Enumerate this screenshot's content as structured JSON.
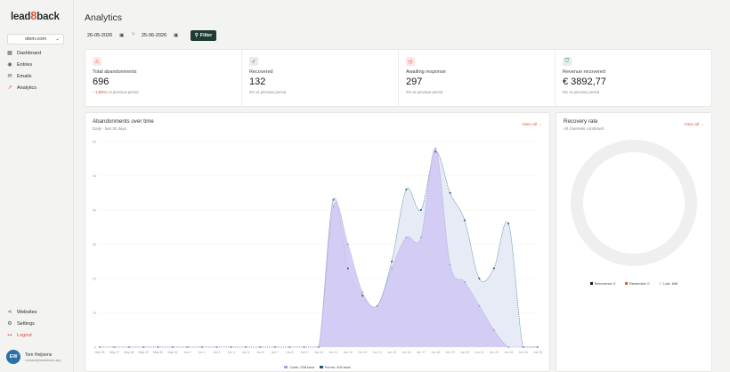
{
  "brand": {
    "part1": "lead",
    "part2": "8",
    "part3": "back"
  },
  "workspace": {
    "name": "olem.com"
  },
  "nav": [
    {
      "label": "Dashboard",
      "icon": "grid-icon"
    },
    {
      "label": "Entries",
      "icon": "eye-icon"
    },
    {
      "label": "Emails",
      "icon": "mail-icon"
    },
    {
      "label": "Analytics",
      "icon": "chart-icon"
    }
  ],
  "nav_bottom": [
    {
      "label": "Websites",
      "icon": "share-icon"
    },
    {
      "label": "Settings",
      "icon": "gear-icon"
    },
    {
      "label": "Logout",
      "icon": "logout-icon"
    }
  ],
  "user": {
    "initials": "EW",
    "name": "Tom Heijnens",
    "email": "contact@leadsback.app"
  },
  "page": {
    "title": "Analytics"
  },
  "filters": {
    "date_from": "26-05-2026",
    "date_to": "25-06-2026",
    "filter_label": "Filter",
    "separator": ">"
  },
  "stats": [
    {
      "label": "Total abandonments",
      "value": "696",
      "arrow": "↑",
      "sub_highlight": "1400%",
      "sub": "vs previous period",
      "icon": "alert-icon",
      "icon_bg": "#fde8e4",
      "icon_color": "#e0553b"
    },
    {
      "label": "Recovered",
      "value": "132",
      "sub": "0% vs previous period",
      "icon": "check-icon",
      "icon_bg": "#e8ece9",
      "icon_color": "#4a5a52"
    },
    {
      "label": "Awaiting response",
      "value": "297",
      "sub": "0% vs previous period",
      "icon": "clock-icon",
      "icon_bg": "#fde8e4",
      "icon_color": "#e0553b"
    },
    {
      "label": "Revenue recovered",
      "value": "€ 3892,77",
      "sub": "0% vs previous period",
      "icon": "wallet-icon",
      "icon_bg": "#e4eeea",
      "icon_color": "#3b6b5c"
    }
  ],
  "abandon_card": {
    "title": "Abandonments over time",
    "subtitle": "Daily - last 30 days",
    "view_all": "View all →"
  },
  "recovery_card": {
    "title": "Recovery rate",
    "subtitle": "All channels combined",
    "view_all": "View all →",
    "legend": [
      {
        "label": "Recovered: 0",
        "color": "#1a1a1a"
      },
      {
        "label": "Reminded: 0",
        "color": "#e0553b"
      },
      {
        "label": "Lost: 696",
        "color": "#e8e8e8"
      }
    ]
  },
  "chart_data": {
    "type": "area",
    "categories": [
      "May 26",
      "May 27",
      "May 28",
      "May 29",
      "May 30",
      "May 31",
      "Jun 1",
      "Jun 2",
      "Jun 3",
      "Jun 4",
      "Jun 5",
      "Jun 6",
      "Jun 7",
      "Jun 8",
      "Jun 9",
      "Jun 10",
      "Jun 11",
      "Jun 12",
      "Jun 13",
      "Jun 14",
      "Jun 15",
      "Jun 16",
      "Jun 17",
      "Jun 18",
      "Jun 19",
      "Jun 20",
      "Jun 21",
      "Jun 22",
      "Jun 23",
      "Jun 24",
      "Jun 25"
    ],
    "yticks": [
      0,
      10,
      20,
      30,
      40,
      50,
      60
    ],
    "ylim": [
      0,
      60
    ],
    "series": [
      {
        "name": "Carts: 298 total",
        "color": "#a99be0",
        "fill": "#cfc7f3",
        "values": [
          0,
          0,
          0,
          0,
          0,
          0,
          0,
          0,
          0,
          0,
          0,
          0,
          0,
          0,
          0,
          0,
          41,
          30,
          16,
          12,
          23,
          32,
          32,
          58,
          24,
          19,
          12,
          5,
          0,
          0,
          0
        ]
      },
      {
        "name": "Forms: 400 total",
        "color": "#1d5b74",
        "fill": "#e3e9f5",
        "values": [
          0,
          0,
          0,
          0,
          0,
          0,
          0,
          0,
          0,
          0,
          0,
          0,
          0,
          0,
          0,
          0,
          43,
          23,
          15,
          12,
          25,
          46,
          40,
          57,
          45,
          37,
          20,
          23,
          36,
          0,
          0
        ]
      }
    ]
  }
}
